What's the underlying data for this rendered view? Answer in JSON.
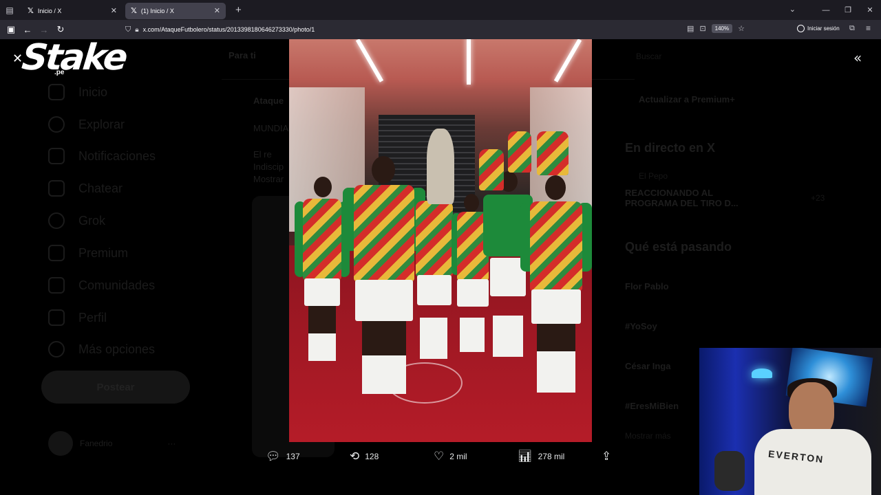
{
  "browser": {
    "tabs": [
      {
        "label": "Inicio / X",
        "active": false
      },
      {
        "label": "(1) Inicio / X",
        "active": true
      }
    ],
    "url": "x.com/AtaqueFutbolero/status/2013398180646273330/photo/1",
    "zoom": "140%",
    "signin_label": "Iniciar sesión"
  },
  "sidebar": {
    "items": [
      {
        "label": "Inicio",
        "icon": "home-icon"
      },
      {
        "label": "Explorar",
        "icon": "search-icon"
      },
      {
        "label": "Notificaciones",
        "icon": "bell-icon"
      },
      {
        "label": "Chatear",
        "icon": "mail-icon"
      },
      {
        "label": "Grok",
        "icon": "grok-icon"
      },
      {
        "label": "Premium",
        "icon": "x-icon"
      },
      {
        "label": "Comunidades",
        "icon": "people-icon"
      },
      {
        "label": "Perfil",
        "icon": "person-icon"
      },
      {
        "label": "Más opciones",
        "icon": "more-icon"
      }
    ],
    "post_button": "Postear",
    "account_name": "Fanedrio"
  },
  "feed": {
    "tab": "Para ti",
    "author": "Ataque",
    "line1": "MUNDIAL",
    "line2": "El re",
    "line3": "Indiscip",
    "line4": "Mostrar"
  },
  "right_column": {
    "search": "Buscar",
    "premium": "Actualizar a Premium+",
    "live_title": "En directo en X",
    "live_host": "El Pepo",
    "live_text": "REACCIONANDO AL PROGRAMA DEL TIRO D...",
    "live_count": "+23",
    "trends_title": "Qué está pasando",
    "trends": [
      "Flor Pablo",
      "#YoSoy",
      "César Inga",
      "#EresMiBien"
    ],
    "show_more": "Mostrar más"
  },
  "overlay": {
    "logo_text": "Stake",
    "logo_sub": ".pe"
  },
  "actions": {
    "replies": "137",
    "reposts": "128",
    "likes": "2 mil",
    "views": "278 mil"
  },
  "webcam": {
    "shirt_text": "EVERTON"
  },
  "colors": {
    "accent": "#1d9bf0",
    "carpet": "#b51c28",
    "kit_green": "#1d8a3a",
    "kit_red": "#d42d2a",
    "kit_yellow": "#e8b93a"
  }
}
